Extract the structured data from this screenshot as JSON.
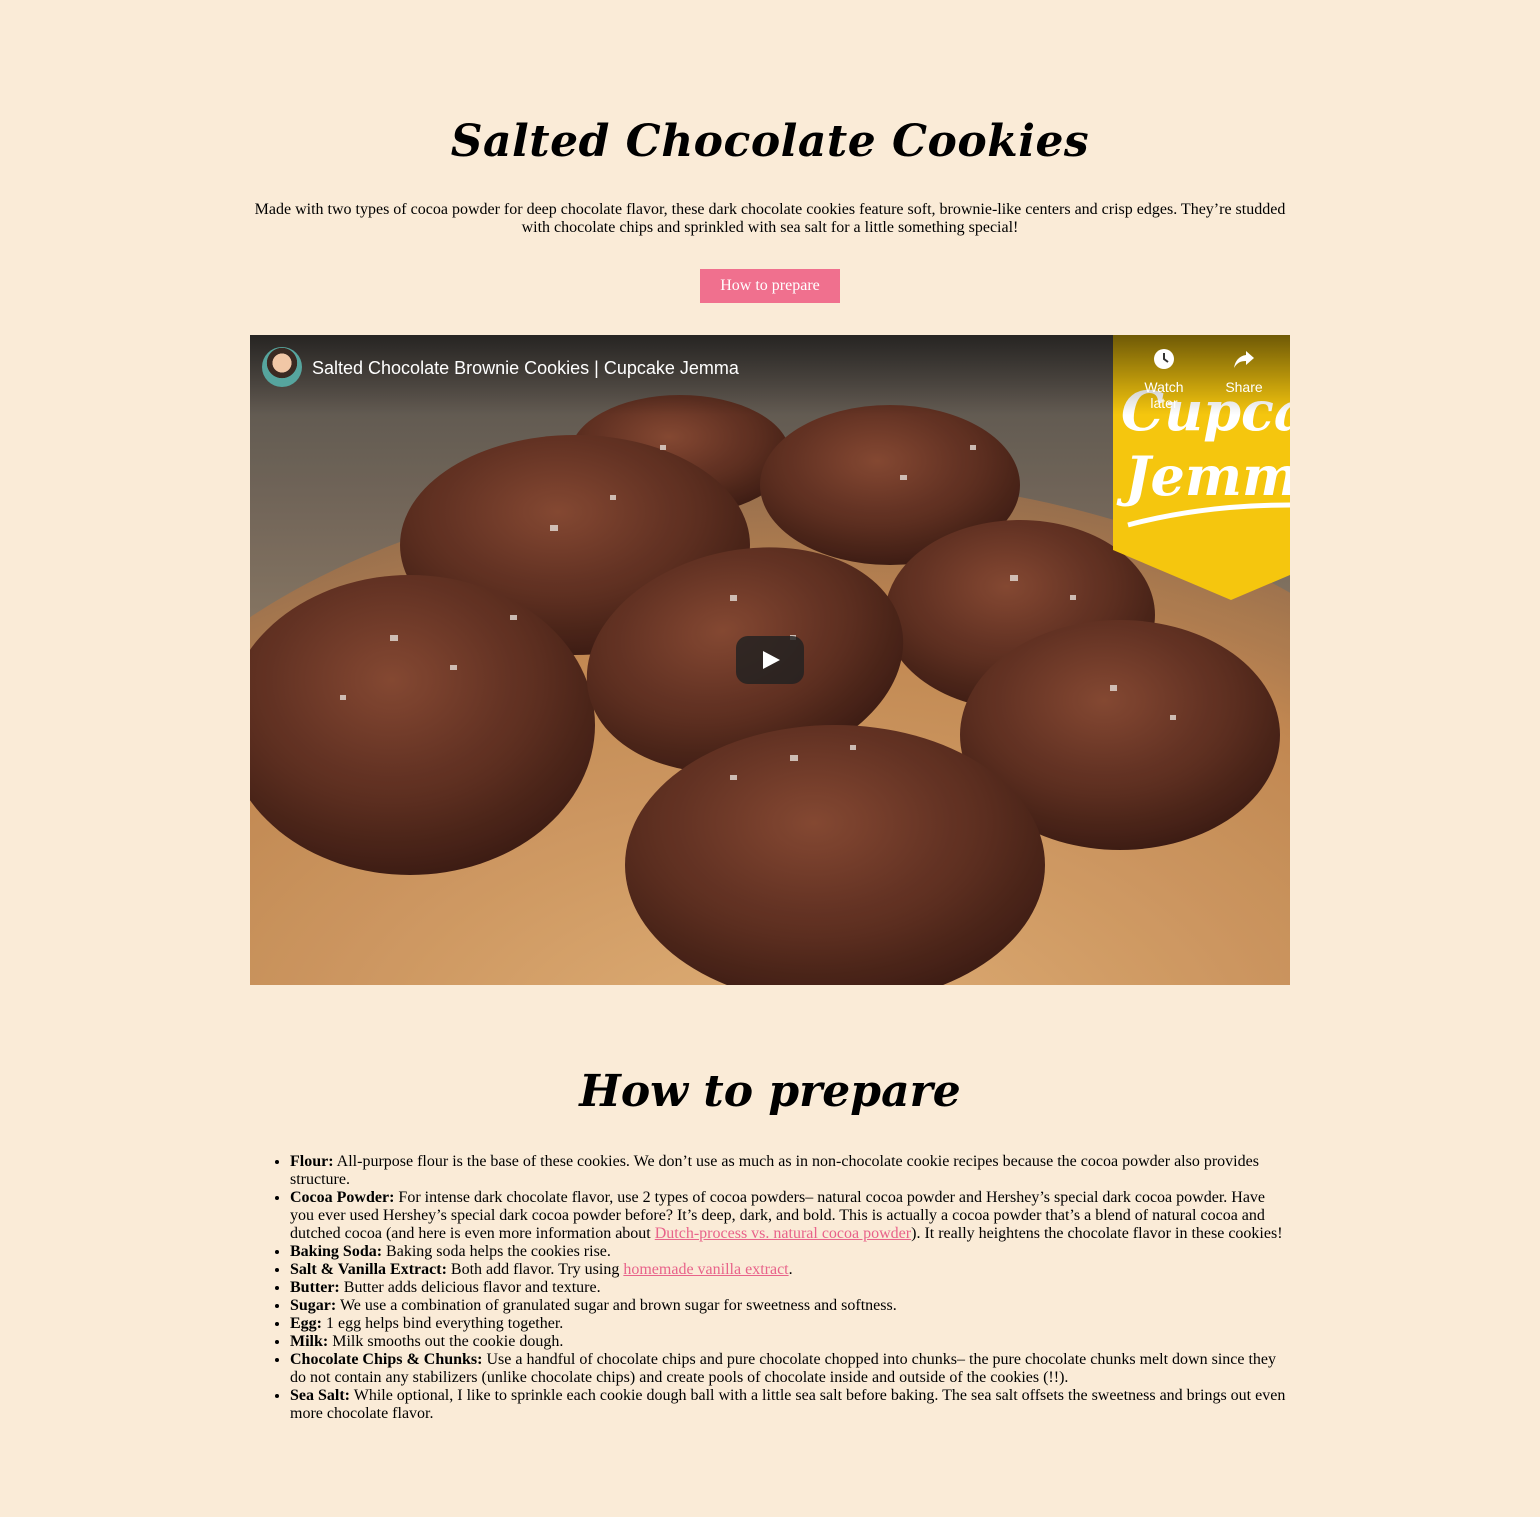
{
  "page": {
    "title": "Salted Chocolate Cookies",
    "intro": "Made with two types of cocoa powder for deep chocolate flavor, these dark chocolate cookies feature soft, brownie-like centers and crisp edges. They’re studded with chocolate chips and sprinkled with sea salt for a little something special!",
    "button_label": "How to prepare",
    "accent_color": "#f0708e",
    "background_color": "#faebd7",
    "link_color": "#e8638a"
  },
  "video": {
    "title": "Salted Chocolate Brownie Cookies | Cupcake Jemma",
    "watch_later_label": "Watch later",
    "share_label": "Share",
    "channel_banner_text_line1": "Cupcak",
    "channel_banner_text_line2": "Jemm",
    "play_icon": "play-icon",
    "watch_later_icon": "clock-icon",
    "share_icon": "share-arrow-icon"
  },
  "section": {
    "heading": "How to prepare"
  },
  "ingredients": [
    {
      "name": "Flour:",
      "text": " All-purpose flour is the base of these cookies. We don’t use as much as in non-chocolate cookie recipes because the cocoa powder also provides structure."
    },
    {
      "name": "Cocoa Powder:",
      "text": " For intense dark chocolate flavor, use 2 types of cocoa powders– natural cocoa powder and Hershey’s special dark cocoa powder. Have you ever used Hershey’s special dark cocoa powder before? It’s deep, dark, and bold. This is actually a cocoa powder that’s a blend of natural cocoa and dutched cocoa (and here is even more information about ",
      "link": "Dutch-process vs. natural cocoa powder",
      "after": "). It really heightens the chocolate flavor in these cookies!"
    },
    {
      "name": "Baking Soda:",
      "text": " Baking soda helps the cookies rise."
    },
    {
      "name": "Salt & Vanilla Extract:",
      "text": " Both add flavor. Try using ",
      "link": "homemade vanilla extract",
      "after": "."
    },
    {
      "name": "Butter:",
      "text": " Butter adds delicious flavor and texture."
    },
    {
      "name": "Sugar:",
      "text": " We use a combination of granulated sugar and brown sugar for sweetness and softness."
    },
    {
      "name": "Egg:",
      "text": " 1 egg helps bind everything together."
    },
    {
      "name": "Milk:",
      "text": " Milk smooths out the cookie dough."
    },
    {
      "name": "Chocolate Chips & Chunks:",
      "text": " Use a handful of chocolate chips and pure chocolate chopped into chunks– the pure chocolate chunks melt down since they do not contain any stabilizers (unlike chocolate chips) and create pools of chocolate inside and outside of the cookies (!!)."
    },
    {
      "name": "Sea Salt:",
      "text": " While optional, I like to sprinkle each cookie dough ball with a little sea salt before baking. The sea salt offsets the sweetness and brings out even more chocolate flavor."
    }
  ]
}
